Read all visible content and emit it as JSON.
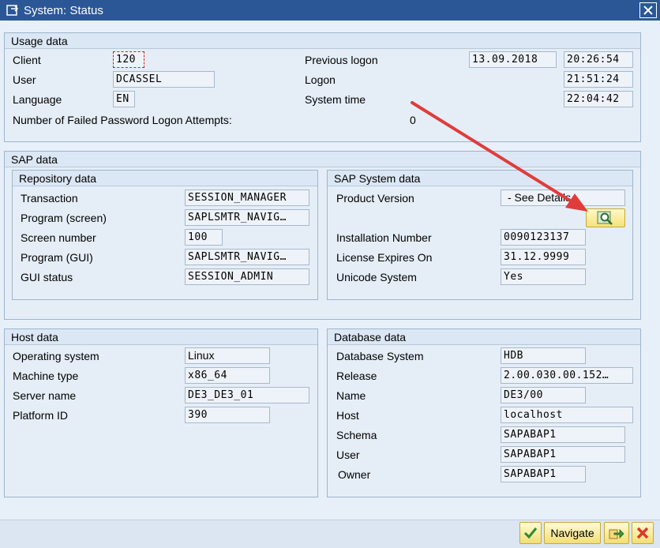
{
  "window": {
    "title": "System: Status"
  },
  "usage": {
    "heading": "Usage data",
    "client_label": "Client",
    "client_value": "120",
    "user_label": "User",
    "user_value": "DCASSEL",
    "language_label": "Language",
    "language_value": "EN",
    "failed_label": "Number of Failed Password Logon Attempts:",
    "failed_value": "0",
    "prev_logon_label": "Previous logon",
    "prev_logon_date": "13.09.2018",
    "prev_logon_time": "20:26:54",
    "logon_label": "Logon",
    "logon_time": "21:51:24",
    "system_time_label": "System time",
    "system_time": "22:04:42"
  },
  "sap": {
    "heading": "SAP data",
    "repo": {
      "heading": "Repository data",
      "transaction_label": "Transaction",
      "transaction": "SESSION_MANAGER",
      "program_screen_label": "Program (screen)",
      "program_screen": "SAPLSMTR_NAVIG…",
      "screen_number_label": "Screen number",
      "screen_number": "100",
      "program_gui_label": "Program (GUI)",
      "program_gui": "SAPLSMTR_NAVIG…",
      "gui_status_label": "GUI status",
      "gui_status": "SESSION_ADMIN"
    },
    "system": {
      "heading": "SAP System data",
      "product_version_label": "Product Version",
      "product_version": "- See Details -",
      "installation_label": "Installation Number",
      "installation": "0090123137",
      "license_label": "License Expires On",
      "license": "31.12.9999",
      "unicode_label": "Unicode System",
      "unicode": "Yes"
    }
  },
  "host": {
    "heading": "Host data",
    "os_label": "Operating system",
    "os": "Linux",
    "machine_label": "Machine type",
    "machine": "x86_64",
    "server_label": "Server name",
    "server": "DE3_DE3_01",
    "platform_label": "Platform ID",
    "platform": "390"
  },
  "database": {
    "heading": "Database data",
    "system_label": "Database System",
    "system": "HDB",
    "release_label": "Release",
    "release": "2.00.030.00.152…",
    "name_label": "Name",
    "name": "DE3/00",
    "host_label": "Host",
    "host": "localhost",
    "schema_label": "Schema",
    "schema": "SAPABAP1",
    "user_label": "User",
    "user": "SAPABAP1",
    "owner_label": "Owner",
    "owner": "SAPABAP1"
  },
  "toolbar": {
    "navigate_label": "Navigate"
  },
  "icons": {
    "window": "window-icon",
    "close": "close-icon",
    "details": "details-magnifier-icon",
    "confirm": "checkmark-icon",
    "copy": "copy-arrow-icon",
    "cancel": "cancel-x-icon"
  },
  "colors": {
    "title_bar": "#2b5797",
    "annotation_arrow": "#e03c3c"
  }
}
